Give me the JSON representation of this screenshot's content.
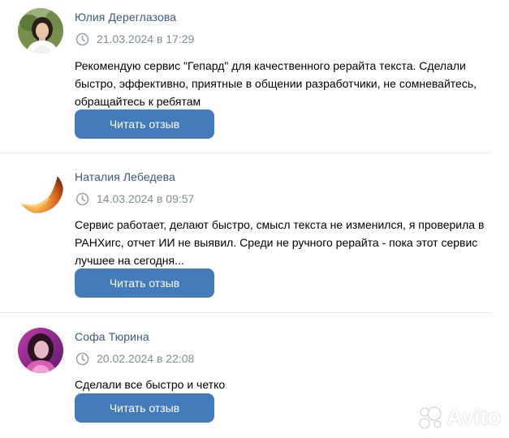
{
  "reviews": [
    {
      "author": "Юлия Дереглазова",
      "date": "21.03.2024 в 17:29",
      "text": "Рекомендую сервис \"Гепард\" для качественного рерайта текста. Сделали быстро, эффективно, приятные в общении разработчики, не сомневайтесь, обращайтесь к ребятам",
      "button_label": "Читать отзыв",
      "avatar_icon": "user-photo"
    },
    {
      "author": "Наталия Лебедева",
      "date": "14.03.2024 в 09:57",
      "text": "Сервис работает, делают быстро, смысл текста не изменился, я проверила в РАНХигс, отчет ИИ не выявил. Среди не ручного рерайта - пока этот сервис лучшее на сегодня...",
      "button_label": "Читать отзыв",
      "avatar_icon": "sunset-photo"
    },
    {
      "author": "Софа Тюрина",
      "date": "20.02.2024 в 22:08",
      "text": "Сделали все быстро и четко",
      "button_label": "Читать отзыв",
      "avatar_icon": "user-photo"
    }
  ],
  "watermark": {
    "text": "Avito",
    "icon": "avito-logo-icon"
  },
  "colors": {
    "author": "#3a5a82",
    "date": "#818c99",
    "button": "#447bba",
    "divider": "#e2e5ea"
  }
}
